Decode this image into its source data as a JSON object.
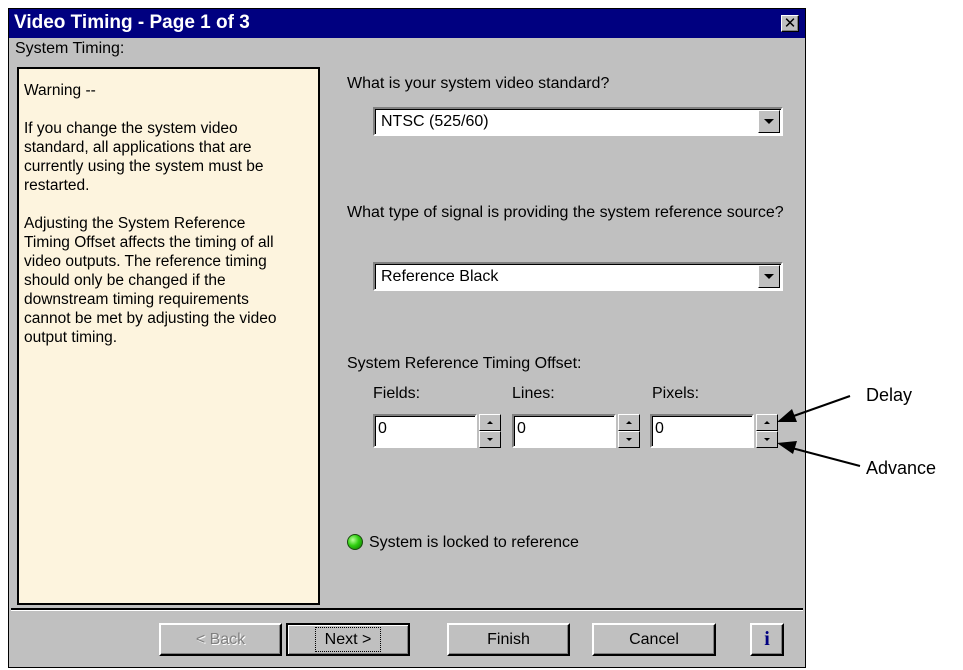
{
  "window": {
    "title": "Video Timing - Page 1 of 3",
    "close_glyph": "✕"
  },
  "group_label": "System Timing:",
  "warning": {
    "heading": "Warning --",
    "para1": "If you change the system video\nstandard, all applications that are\ncurrently using the system must be\nrestarted.",
    "para2": "Adjusting the System Reference\nTiming Offset affects the timing of all\nvideo outputs.  The reference timing\nshould only be changed if the\ndownstream timing requirements\ncannot be met by adjusting the video\noutput timing."
  },
  "video_standard": {
    "question": "What is your system video standard?",
    "selected": "NTSC (525/60)"
  },
  "reference_signal": {
    "question": "What type of signal is providing the system reference source?",
    "selected": "Reference Black"
  },
  "timing_offset": {
    "label": "System Reference Timing Offset:",
    "fields": [
      {
        "label": "Fields:",
        "value": "0"
      },
      {
        "label": "Lines:",
        "value": "0"
      },
      {
        "label": "Pixels:",
        "value": "0"
      }
    ]
  },
  "status": {
    "text": "System is locked to reference",
    "indicator_color": "#2fcf10"
  },
  "buttons": {
    "back": "< Back",
    "next": "Next >",
    "finish": "Finish",
    "cancel": "Cancel",
    "info": "i"
  },
  "callouts": {
    "delay": "Delay",
    "advance": "Advance"
  },
  "colors": {
    "titlebar": "#000080",
    "dialog_face": "#c0c0c0",
    "warning_background": "#fdf4de"
  }
}
